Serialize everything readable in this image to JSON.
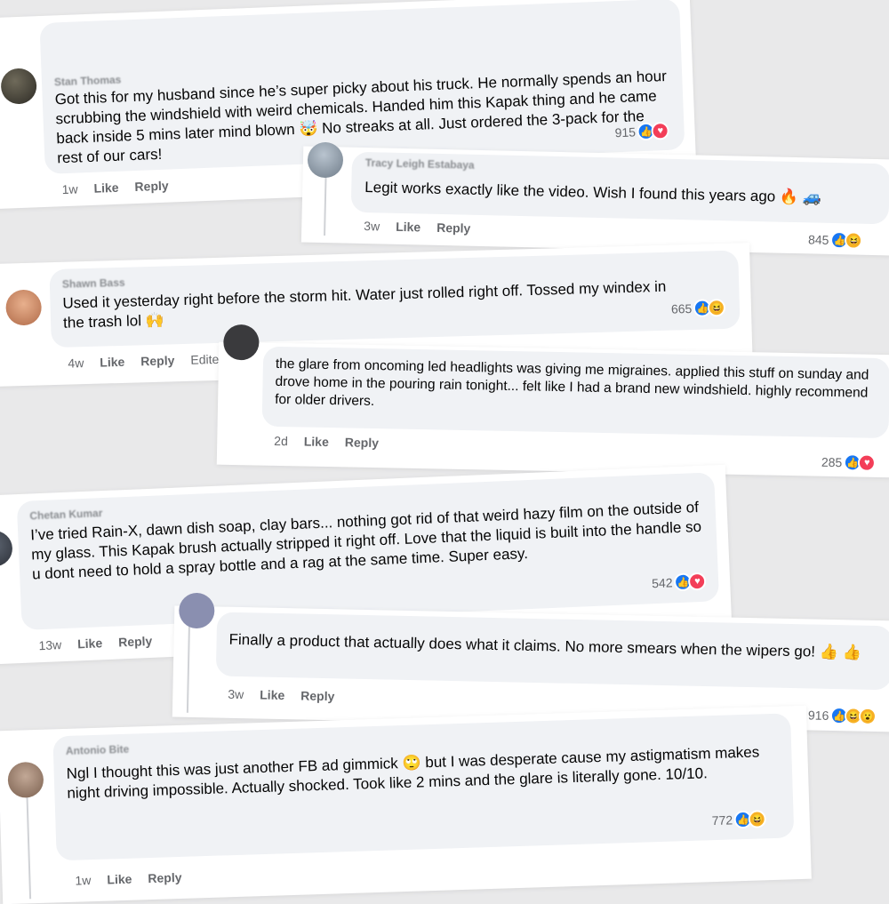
{
  "comments": [
    {
      "name": "Stan Thomas",
      "text": "Got this for my husband since he’s super picky about his truck. He normally spends an hour scrubbing the windshield with weird chemicals. Handed him this Kapak thing and he came back inside 5 mins later mind blown 🤯 No streaks at all. Just ordered the 3-pack for the rest of our cars!",
      "count": "915",
      "time": "1w",
      "like": "Like",
      "reply": "Reply",
      "reactions": [
        "like-icon",
        "love-icon"
      ]
    },
    {
      "name": "Tracy Leigh Estabaya",
      "text": "Legit works exactly like the video. Wish I found this years ago 🔥 🚙",
      "count": "845",
      "time": "3w",
      "like": "Like",
      "reply": "Reply",
      "reactions": [
        "like-icon",
        "haha-icon"
      ]
    },
    {
      "name": "Shawn Bass",
      "text": "Used it yesterday right before the storm hit. Water just rolled right off. Tossed my windex in the trash lol 🙌",
      "count": "665",
      "time": "4w",
      "like": "Like",
      "reply": "Reply",
      "edited": "Edited",
      "reactions": [
        "like-icon",
        "haha-icon"
      ]
    },
    {
      "name": "",
      "text": "the glare from oncoming led headlights was giving me migraines. applied this stuff on sunday and drove home in the pouring rain tonight... felt like I had a brand new windshield. highly recommend for older drivers.",
      "count": "285",
      "time": "2d",
      "like": "Like",
      "reply": "Reply",
      "reactions": [
        "like-icon",
        "love-icon"
      ]
    },
    {
      "name": "Chetan Kumar",
      "text": "I’ve tried Rain-X, dawn dish soap, clay bars... nothing got rid of that weird hazy film on the outside of my glass. This Kapak brush actually stripped it right off. Love that the liquid is built into the handle so u dont need to hold a spray bottle and a rag at the same time. Super easy.",
      "count": "542",
      "time": "13w",
      "like": "Like",
      "reply": "Reply",
      "reactions": [
        "like-icon",
        "love-icon"
      ]
    },
    {
      "name": "",
      "text": "Finally a product that actually does what it claims. No more smears when the wipers go! 👍 👍",
      "count": "916",
      "time": "3w",
      "like": "Like",
      "reply": "Reply",
      "reactions": [
        "like-icon",
        "haha-icon",
        "wow-icon"
      ]
    },
    {
      "name": "Antonio Bite",
      "text": "Ngl I thought this was just another FB ad gimmick 🙄 but I was desperate cause my astigmatism makes night driving impossible. Actually shocked. Took like 2 mins and the glare is literally gone. 10/10.",
      "count": "772",
      "time": "1w",
      "like": "Like",
      "reply": "Reply",
      "reactions": [
        "like-icon",
        "haha-icon"
      ]
    }
  ],
  "colors": {
    "like": "#1877f2",
    "love": "#f33e58",
    "haha": "#f7b125",
    "bubble": "#f0f2f5"
  }
}
